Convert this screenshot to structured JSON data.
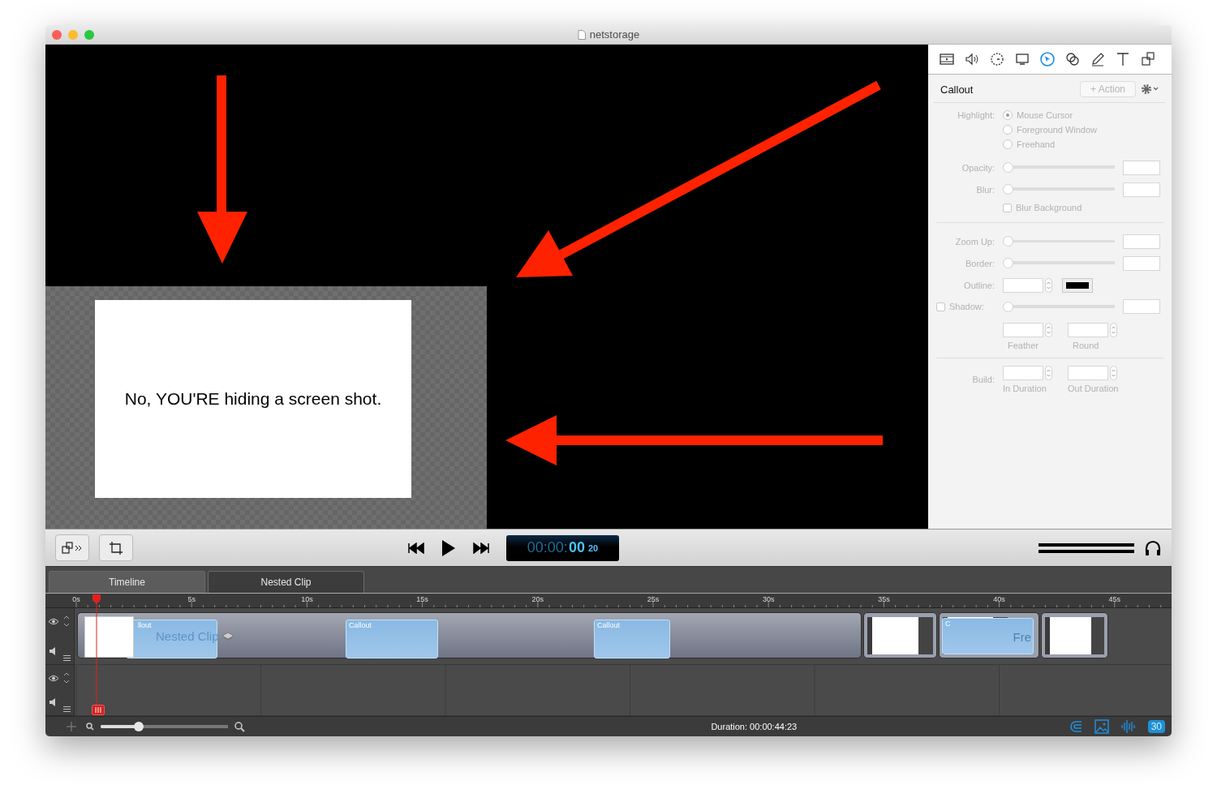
{
  "window": {
    "title": "netstorage"
  },
  "canvas": {
    "caption": "No, YOU'RE hiding a screen shot."
  },
  "inspector": {
    "disabled": true,
    "tools": [
      {
        "kind": "film",
        "selected": false
      },
      {
        "kind": "audio",
        "selected": false
      },
      {
        "kind": "timer",
        "selected": false
      },
      {
        "kind": "screen",
        "selected": false
      },
      {
        "kind": "cursor",
        "selected": true
      },
      {
        "kind": "filters",
        "selected": false
      },
      {
        "kind": "pen",
        "selected": false
      },
      {
        "kind": "text",
        "selected": false
      },
      {
        "kind": "media",
        "selected": false
      }
    ],
    "title": "Callout",
    "action": "+ Action",
    "highlight": {
      "label": "Highlight:",
      "options": [
        {
          "label": "Mouse Cursor",
          "selected": true
        },
        {
          "label": "Foreground Window",
          "selected": false
        },
        {
          "label": "Freehand",
          "selected": false
        }
      ]
    },
    "sliders_1": [
      {
        "label": "Opacity:",
        "level": 0
      },
      {
        "label": "Blur:",
        "level": 0
      }
    ],
    "blur_background": {
      "label": "Blur Background",
      "checked": false
    },
    "sliders_2": [
      {
        "label": "Zoom Up:",
        "level": 0
      },
      {
        "label": "Border:",
        "level": 0
      }
    ],
    "outline": {
      "label": "Outline:",
      "color": "#000000"
    },
    "shadow": {
      "label": "Shadow:",
      "checked": false,
      "level": 0
    },
    "shape_fields": [
      {
        "label": "Feather"
      },
      {
        "label": "Round"
      }
    ],
    "build": {
      "label": "Build:",
      "fields": [
        {
          "label": "In Duration"
        },
        {
          "label": "Out Duration"
        }
      ]
    }
  },
  "toolbar": {
    "timecode_dim": "00:00:",
    "timecode_bright": "00",
    "timecode_frames": "20"
  },
  "tabs": [
    {
      "label": "Timeline",
      "selected": true
    },
    {
      "label": "Nested Clip",
      "selected": false
    }
  ],
  "ruler": [
    "0s",
    "5s",
    "10s",
    "15s",
    "20s",
    "25s",
    "30s",
    "35s",
    "40s",
    "45s"
  ],
  "clips": [
    {
      "kind": "group",
      "label": "Nested Clip"
    },
    {
      "kind": "callout",
      "label": "llout"
    },
    {
      "kind": "callout",
      "label": "Callout"
    },
    {
      "kind": "callout",
      "label": "Callout"
    },
    {
      "kind": "screen"
    },
    {
      "kind": "screen_callout",
      "label": "C",
      "label_2": "Fre"
    },
    {
      "kind": "screen"
    }
  ],
  "zoom": {
    "level": 0.3
  },
  "status": {
    "duration": "Duration: 00:00:44:23",
    "fps": "30"
  }
}
